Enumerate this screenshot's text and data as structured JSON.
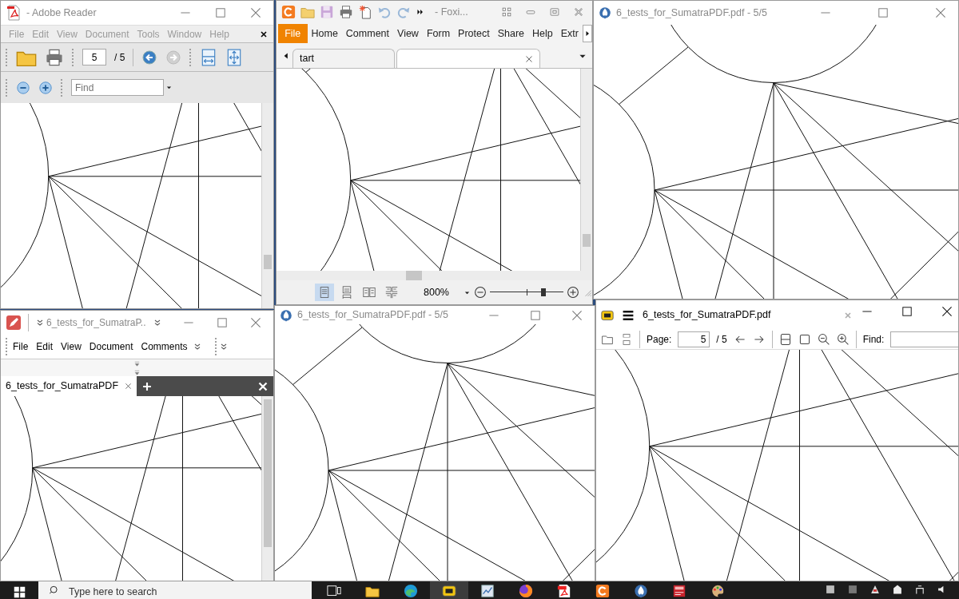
{
  "windows": [
    {
      "kind": "adobe",
      "title": "- Adobe Reader",
      "active": false,
      "menu": [
        {
          "label": "File",
          "disabled": true
        },
        {
          "label": "Edit",
          "disabled": true
        },
        {
          "label": "View",
          "disabled": true
        },
        {
          "label": "Document",
          "disabled": true
        },
        {
          "label": "Tools",
          "disabled": true
        },
        {
          "label": "Window",
          "disabled": true
        },
        {
          "label": "Help",
          "disabled": true
        }
      ],
      "page_field": "5",
      "page_total": "/ 5",
      "forward_disabled": true,
      "find_placeholder": "Find"
    },
    {
      "kind": "foxit",
      "title": "- Foxi...",
      "active": false,
      "ribbon_tabs": [
        {
          "label": "File",
          "selected": true
        },
        {
          "label": "Home",
          "selected": false
        },
        {
          "label": "Comment",
          "selected": false
        },
        {
          "label": "View",
          "selected": false
        },
        {
          "label": "Form",
          "selected": false
        },
        {
          "label": "Protect",
          "selected": false
        },
        {
          "label": "Share",
          "selected": false
        },
        {
          "label": "Help",
          "selected": false
        },
        {
          "label": "Extr",
          "selected": false
        }
      ],
      "doc_tabs": [
        {
          "label": "tart",
          "selected": false
        },
        {
          "selected": true
        }
      ],
      "view_modes": [
        {
          "selected": true
        },
        {
          "selected": false
        },
        {
          "selected": false
        },
        {
          "selected": false
        }
      ],
      "zoom": "800%",
      "zoom_slider": {
        "level": 0.73
      }
    },
    {
      "kind": "sumatra",
      "title": "6_tests_for_SumatraPDF.pdf - 5/5",
      "active": false
    },
    {
      "kind": "editor",
      "title": "6_tests_for_SumatraP..",
      "active": false,
      "menu": [
        {
          "label": "File"
        },
        {
          "label": "Edit"
        },
        {
          "label": "View"
        },
        {
          "label": "Document"
        },
        {
          "label": "Comments"
        }
      ],
      "doc_tabs": [
        {
          "label": "6_tests_for_SumatraPDF",
          "selected": true
        }
      ]
    },
    {
      "kind": "sumatra",
      "title": "6_tests_for_SumatraPDF.pdf - 5/5",
      "active": false
    },
    {
      "kind": "sumatra_toolbar",
      "title": "6_tests_for_SumatraPDF.pdf",
      "active": true,
      "page_label": "Page:",
      "page_field": "5",
      "page_total": "/ 5",
      "find_label": "Find:"
    }
  ],
  "taskbar": {
    "search_placeholder": "Type here to search",
    "apps": [
      {
        "kind": "taskview",
        "selected": false
      },
      {
        "kind": "folder",
        "selected": false
      },
      {
        "kind": "edge",
        "selected": false
      },
      {
        "kind": "pdfyellow",
        "selected": true
      },
      {
        "kind": "chart",
        "selected": false
      },
      {
        "kind": "firefox",
        "selected": false
      },
      {
        "kind": "acrobat",
        "selected": false
      },
      {
        "kind": "foxit",
        "selected": false
      },
      {
        "kind": "sumatra",
        "selected": false
      },
      {
        "kind": "pdfred",
        "selected": false
      },
      {
        "kind": "paint",
        "selected": false
      }
    ]
  }
}
